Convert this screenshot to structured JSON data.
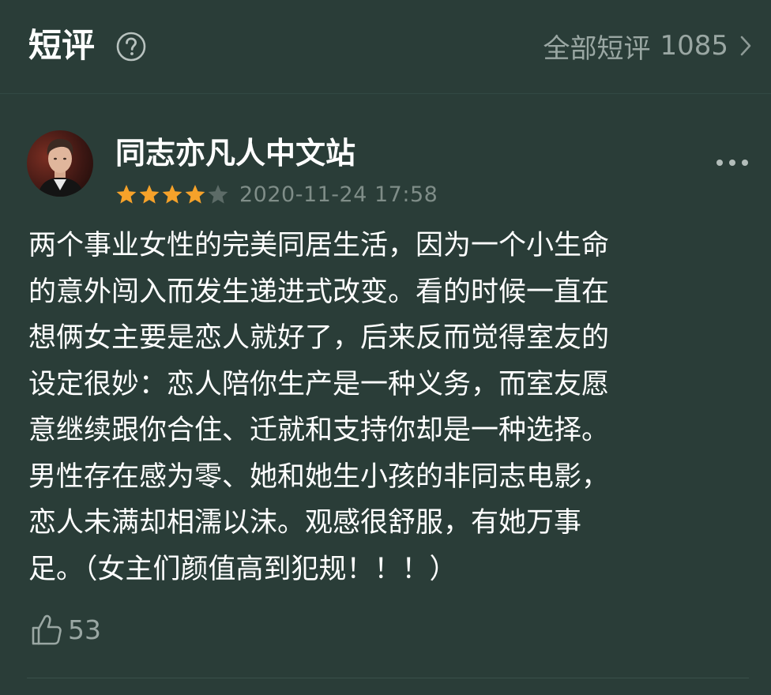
{
  "header": {
    "title": "短评",
    "all_label": "全部短评",
    "all_count": "1085"
  },
  "review": {
    "username": "同志亦凡人中文站",
    "rating": 4,
    "rating_max": 5,
    "timestamp": "2020-11-24 17:58",
    "content": "两个事业女性的完美同居生活，因为一个小生命\n的意外闯入而发生递进式改变。看的时候一直在\n想俩女主要是恋人就好了，后来反而觉得室友的\n设定很妙：恋人陪你生产是一种义务，而室友愿\n意继续跟你合住、迁就和支持你却是一种选择。\n男性存在感为零、她和她生小孩的非同志电影，\n恋人未满却相濡以沫。观感很舒服，有她万事\n足。（女主们颜值高到犯规！！！）",
    "likes": "53"
  },
  "icons": {
    "help": "question-circle-icon",
    "chevron": "chevron-right-icon",
    "more": "more-dots-icon",
    "star": "star-icon",
    "like": "thumbs-up-icon"
  },
  "colors": {
    "background": "#2a3d38",
    "star_filled": "#f6a22a",
    "star_empty": "#5c6b67",
    "muted_text": "#9aa7a3",
    "timestamp": "#7f8d88"
  }
}
